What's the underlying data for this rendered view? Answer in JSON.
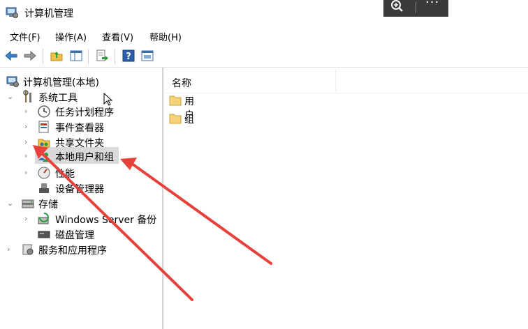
{
  "window": {
    "title": "计算机管理"
  },
  "menu": [
    {
      "label": "文件(F)"
    },
    {
      "label": "操作(A)"
    },
    {
      "label": "查看(V)"
    },
    {
      "label": "帮助(H)"
    }
  ],
  "toolbar": {
    "icons": [
      "back-icon",
      "forward-icon",
      "up-folder-icon",
      "show-hide-tree-icon",
      "export-list-icon",
      "help-icon",
      "properties-icon"
    ]
  },
  "tree": {
    "root": "计算机管理(本地)",
    "system_tools": "系统工具",
    "task_scheduler": "任务计划程序",
    "event_viewer": "事件查看器",
    "shared_folders": "共享文件夹",
    "local_users": "本地用户和组",
    "performance": "性能",
    "device_manager": "设备管理器",
    "storage": "存储",
    "windows_backup": "Windows Server 备份",
    "disk_management": "磁盘管理",
    "services_apps": "服务和应用程序"
  },
  "right": {
    "column_name": "名称",
    "items": [
      {
        "label": "用户"
      },
      {
        "label": "组"
      }
    ]
  },
  "colors": {
    "annotation_arrow": "#e8413c",
    "selected_bg": "#d9d9d9"
  }
}
